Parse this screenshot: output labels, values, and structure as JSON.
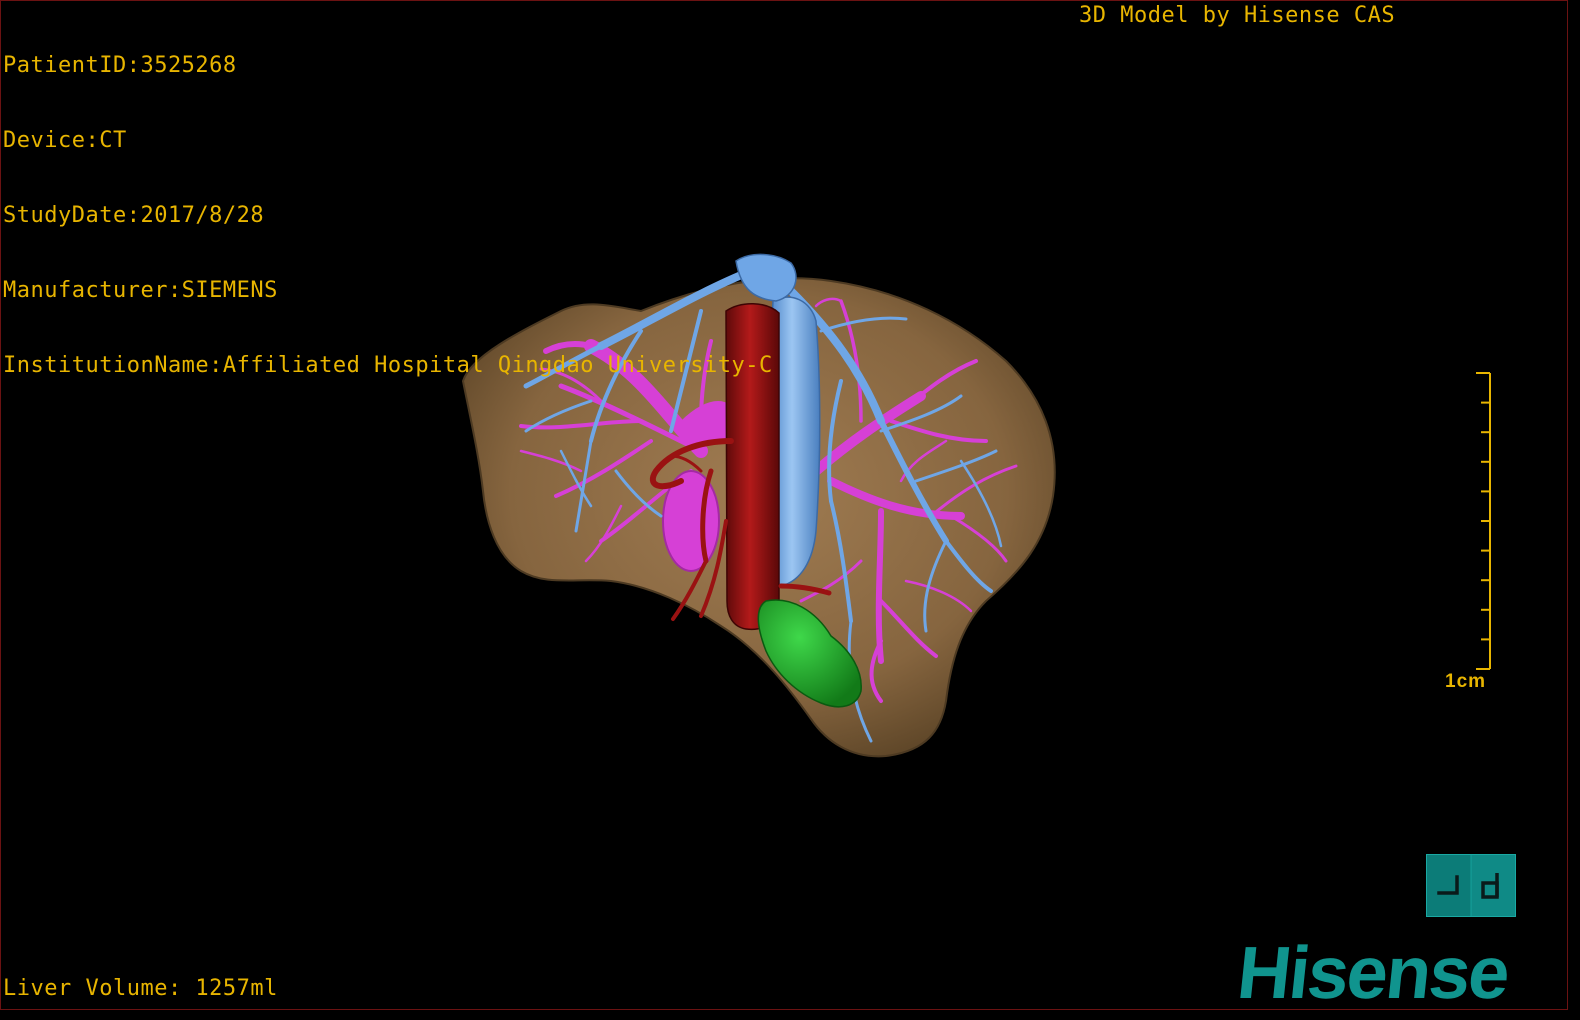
{
  "study_info": {
    "patient_id": "PatientID:3525268",
    "device": "Device:CT",
    "study_date": "StudyDate:2017/8/28",
    "manufacturer": "Manufacturer:SIEMENS",
    "institution": "InstitutionName:Affiliated Hospital Qingdao University-C"
  },
  "watermark": "3D Model by Hisense CAS",
  "liver_volume": "Liver Volume: 1257ml",
  "scale": {
    "label": "1cm"
  },
  "orientation_widget": {
    "icon": "orientation-cube-icon"
  },
  "brand": {
    "logo_text": "Hisense",
    "logo_color": "#10948e"
  },
  "colors": {
    "overlay_text": "#e8b500",
    "liver": "#8c6a46",
    "hepatic_vein": "#6fa6e6",
    "portal_vein": "#d640d6",
    "artery": "#9a1212",
    "tumor": "#22a02a",
    "frame": "#6b1212"
  },
  "model_structures": [
    "liver",
    "hepatic-vein",
    "portal-vein",
    "inferior-vena-cava",
    "hepatic-artery",
    "tumor"
  ]
}
